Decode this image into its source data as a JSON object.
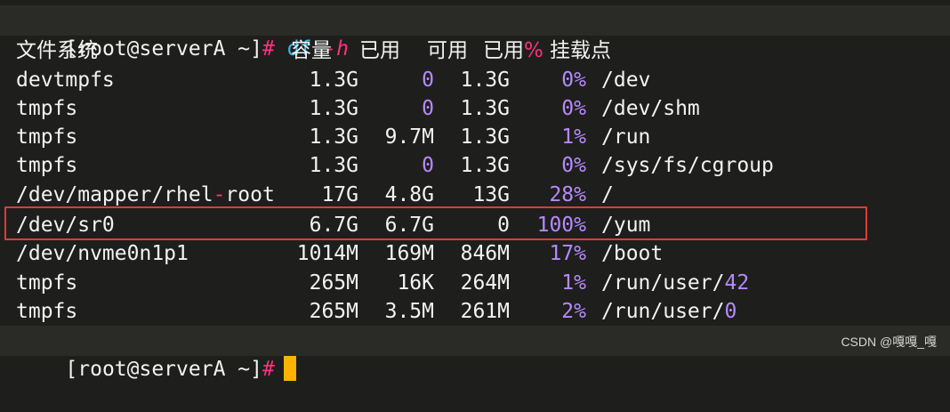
{
  "prompt": {
    "open_bracket": "[",
    "user_host": "root@serverA",
    "space": " ",
    "cwd": "~",
    "close_bracket": "]",
    "hash": "#"
  },
  "command": {
    "name": "df",
    "flag": "-h"
  },
  "header": {
    "filesystem": "文件系统",
    "size": "容量",
    "used": "已用",
    "avail": "可用",
    "use_pct_text": "已用",
    "use_pct_symbol": "%",
    "mount": "挂载点"
  },
  "rows": [
    {
      "fs": "devtmpfs",
      "size": "1.3G",
      "used": "0",
      "avail": "1.3G",
      "pct": "0%",
      "mount": "/dev"
    },
    {
      "fs": "tmpfs",
      "size": "1.3G",
      "used": "0",
      "avail": "1.3G",
      "pct": "0%",
      "mount": "/dev/shm"
    },
    {
      "fs": "tmpfs",
      "size": "1.3G",
      "used": "9.7M",
      "avail": "1.3G",
      "pct": "1%",
      "mount": "/run"
    },
    {
      "fs": "tmpfs",
      "size": "1.3G",
      "used": "0",
      "avail": "1.3G",
      "pct": "0%",
      "mount": "/sys/fs/cgroup"
    },
    {
      "fs_prefix": "/dev/mapper/rhel",
      "fs_dash": "-",
      "fs_suffix": "root",
      "size": "17G",
      "used": "4.8G",
      "avail": "13G",
      "pct": "28%",
      "mount": "/"
    },
    {
      "fs": "/dev/sr0",
      "size": "6.7G",
      "used": "6.7G",
      "avail": "0",
      "pct": "100%",
      "mount": "/yum"
    },
    {
      "fs": "/dev/nvme0n1p1",
      "size": "1014M",
      "used": "169M",
      "avail": "846M",
      "pct": "17%",
      "mount": "/boot"
    },
    {
      "fs": "tmpfs",
      "size": "265M",
      "used": "16K",
      "avail": "264M",
      "pct": "1%",
      "mount_prefix": "/run/user/",
      "mount_suffix": "42"
    },
    {
      "fs": "tmpfs",
      "size": "265M",
      "used": "3.5M",
      "avail": "261M",
      "pct": "2%",
      "mount_prefix": "/run/user/",
      "mount_suffix": "0"
    }
  ],
  "watermark": "CSDN @嘎嘎_嘎",
  "colors": {
    "background": "#1e1f1c",
    "prompt_hash": "#ff2f7f",
    "command": "#3fb5e6",
    "number_accent": "#b689ff",
    "highlight_box": "#e03a3a",
    "cursor": "#ffb300"
  }
}
